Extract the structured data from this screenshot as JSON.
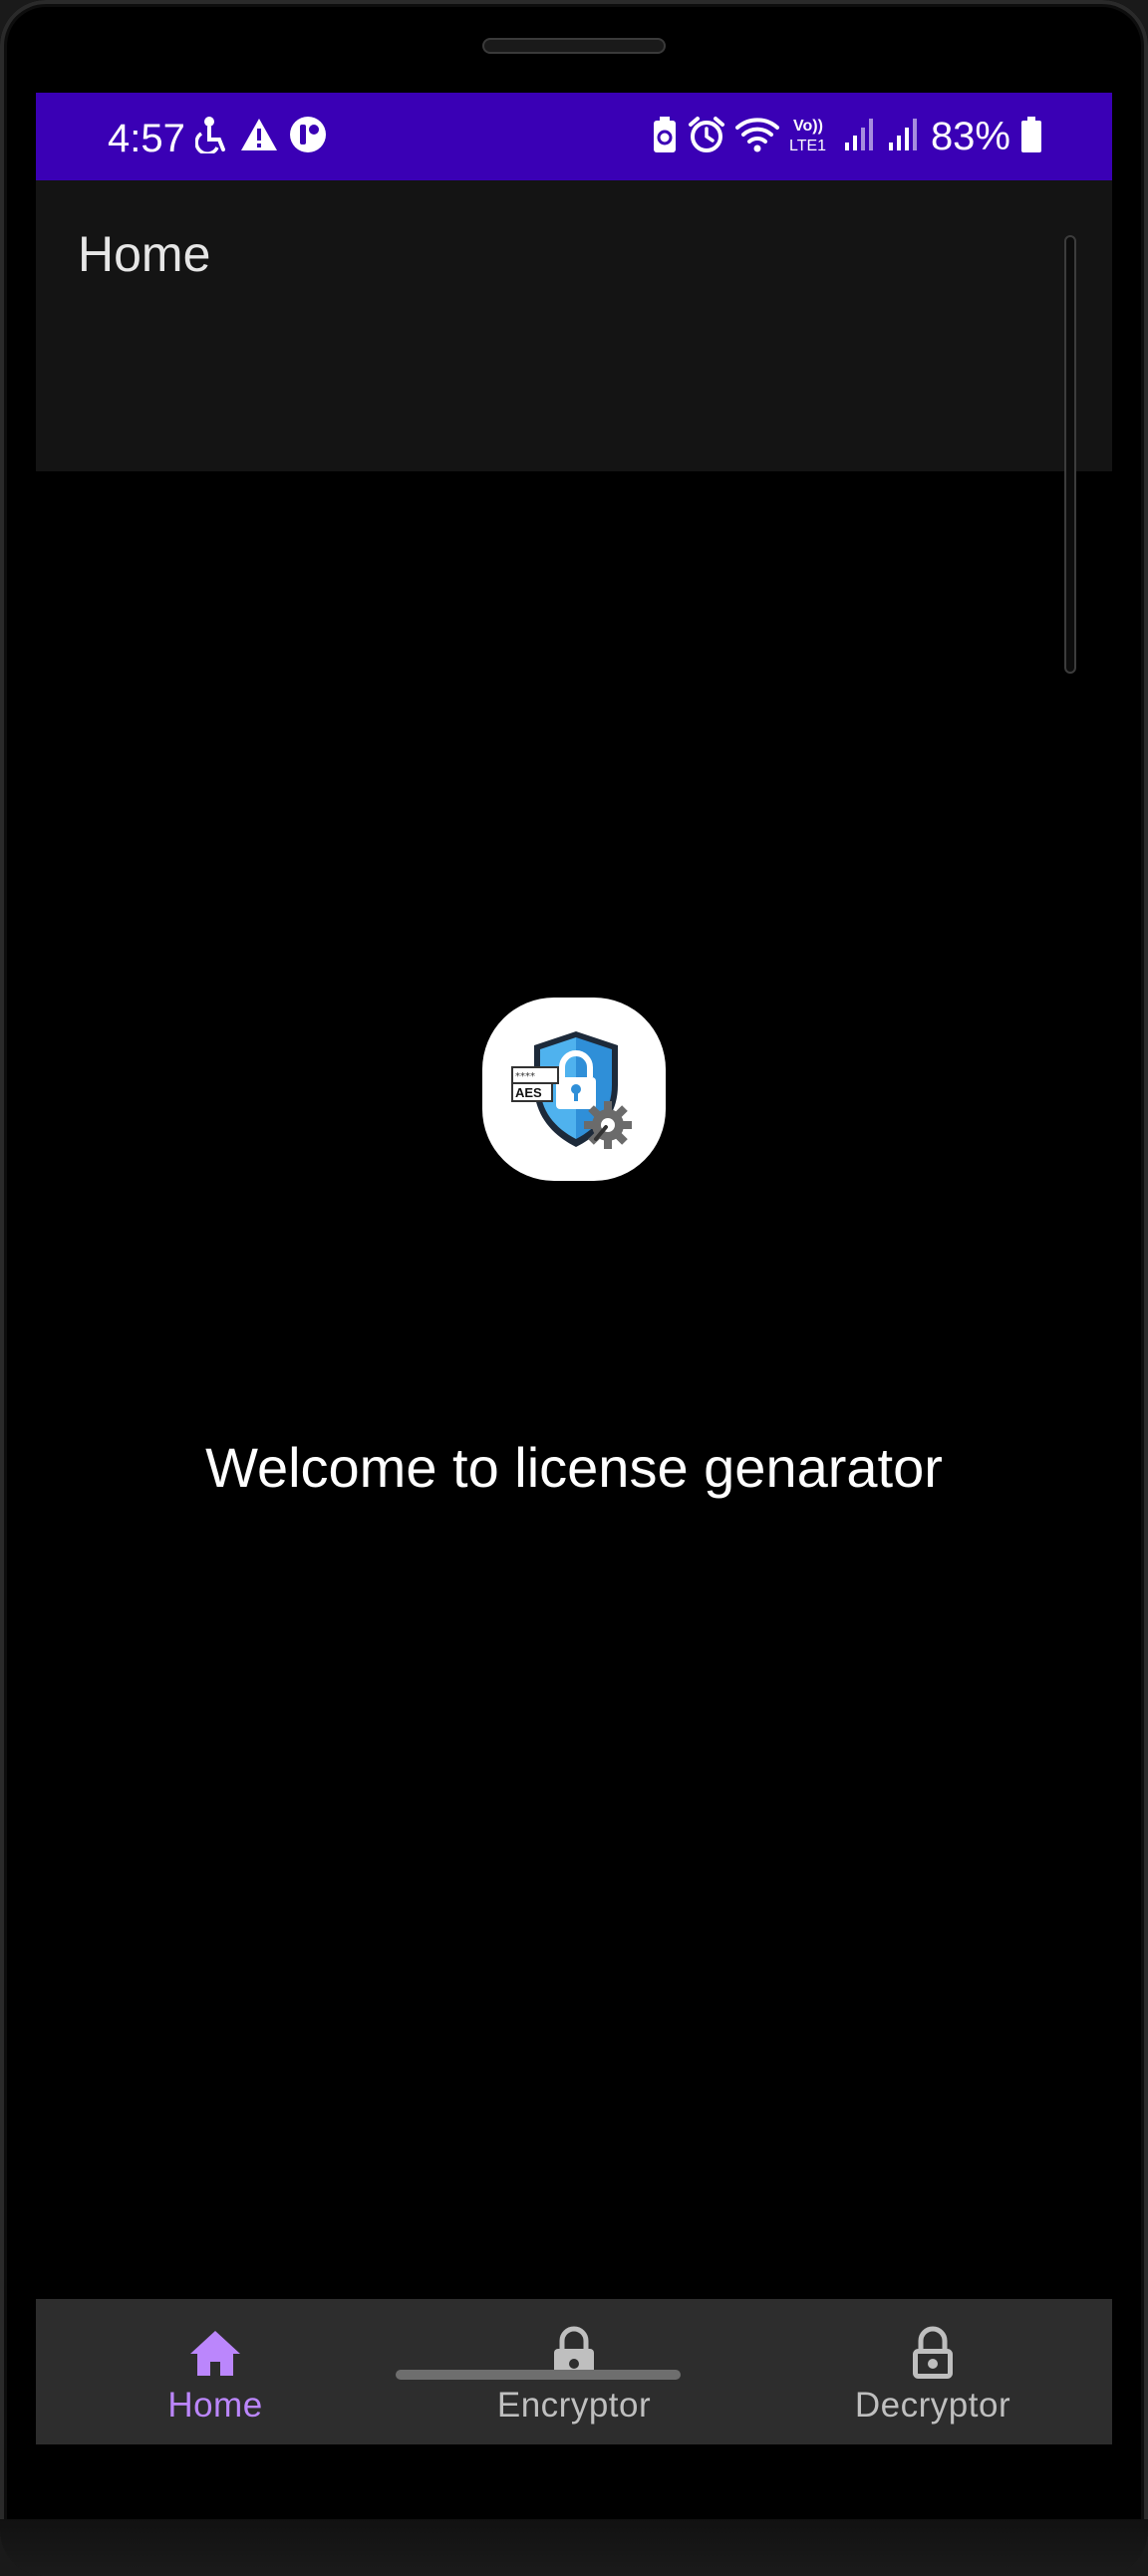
{
  "status_bar": {
    "time": "4:57",
    "battery": "83%",
    "color": "#3a00b5",
    "left_icons": [
      "accessibility-icon",
      "warning-icon",
      "notification-app-icon"
    ],
    "right_icons": [
      "battery-saver-icon",
      "alarm-icon",
      "wifi-icon",
      "volte-lte1-icon",
      "signal-icon",
      "signal-icon",
      "battery-icon"
    ],
    "network_label_top": "Vo))",
    "network_label_bottom": "LTE1"
  },
  "app_bar": {
    "title": "Home",
    "color": "#141414"
  },
  "main": {
    "app_icon": "aes-shield-lock-icon",
    "app_icon_badge": "AES",
    "welcome_text": "Welcome to license genarator"
  },
  "bottom_nav": {
    "active_color": "#bb86fc",
    "items": [
      {
        "label": "Home",
        "icon": "home-icon",
        "active": true
      },
      {
        "label": "Encryptor",
        "icon": "lock-icon",
        "active": false
      },
      {
        "label": "Decryptor",
        "icon": "unlock-icon",
        "active": false
      }
    ]
  }
}
